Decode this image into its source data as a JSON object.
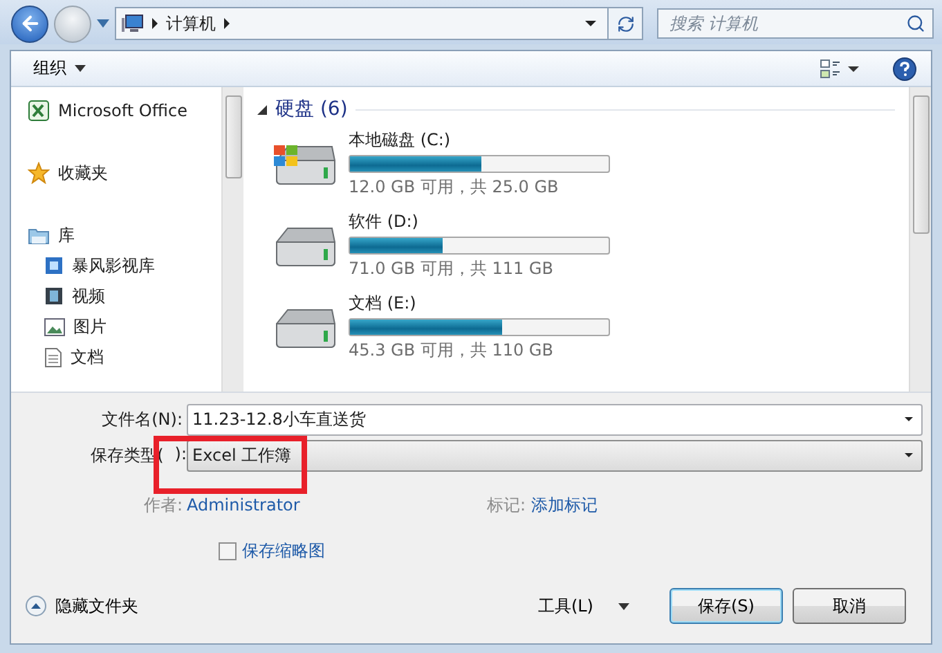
{
  "address_bar": {
    "path": [
      "计算机"
    ]
  },
  "search": {
    "placeholder": "搜索 计算机"
  },
  "toolbar": {
    "organize": "组织"
  },
  "nav_pane": {
    "items": [
      {
        "label": "Microsoft Office",
        "kind": "office"
      },
      {
        "label": "收藏夹",
        "kind": "favorites"
      },
      {
        "label": "库",
        "kind": "library",
        "children": [
          {
            "label": "暴风影视库",
            "kind": "media"
          },
          {
            "label": "视频",
            "kind": "video"
          },
          {
            "label": "图片",
            "kind": "pictures"
          },
          {
            "label": "文档",
            "kind": "documents"
          }
        ]
      }
    ]
  },
  "content": {
    "group": {
      "title": "硬盘 (6)",
      "expanded": true
    },
    "drives": [
      {
        "name": "本地磁盘 (C:)",
        "kind": "system",
        "level": 0.51,
        "info": "12.0 GB 可用，共 25.0 GB"
      },
      {
        "name": "软件 (D:)",
        "kind": "plain",
        "level": 0.36,
        "info": "71.0 GB 可用，共 111 GB"
      },
      {
        "name": "文档 (E:)",
        "kind": "plain",
        "level": 0.59,
        "info": "45.3 GB 可用，共 110 GB"
      }
    ]
  },
  "form": {
    "filename": {
      "label": "文件名(N):",
      "value": "11.23-12.8小车直送货"
    },
    "filetype": {
      "label_parts": [
        "保存类型(",
        "):"
      ],
      "value": "Excel 工作簿"
    },
    "author": {
      "label": "作者:",
      "value": "Administrator"
    },
    "tags": {
      "label": "标记:",
      "value": "添加标记"
    },
    "thumbnail": {
      "label": "保存缩略图",
      "checked": false
    }
  },
  "footer": {
    "hide_folders": "隐藏文件夹",
    "tools": "工具(L)",
    "save": "保存(S)",
    "cancel": "取消"
  },
  "annotation": {
    "kind": "highlight"
  }
}
